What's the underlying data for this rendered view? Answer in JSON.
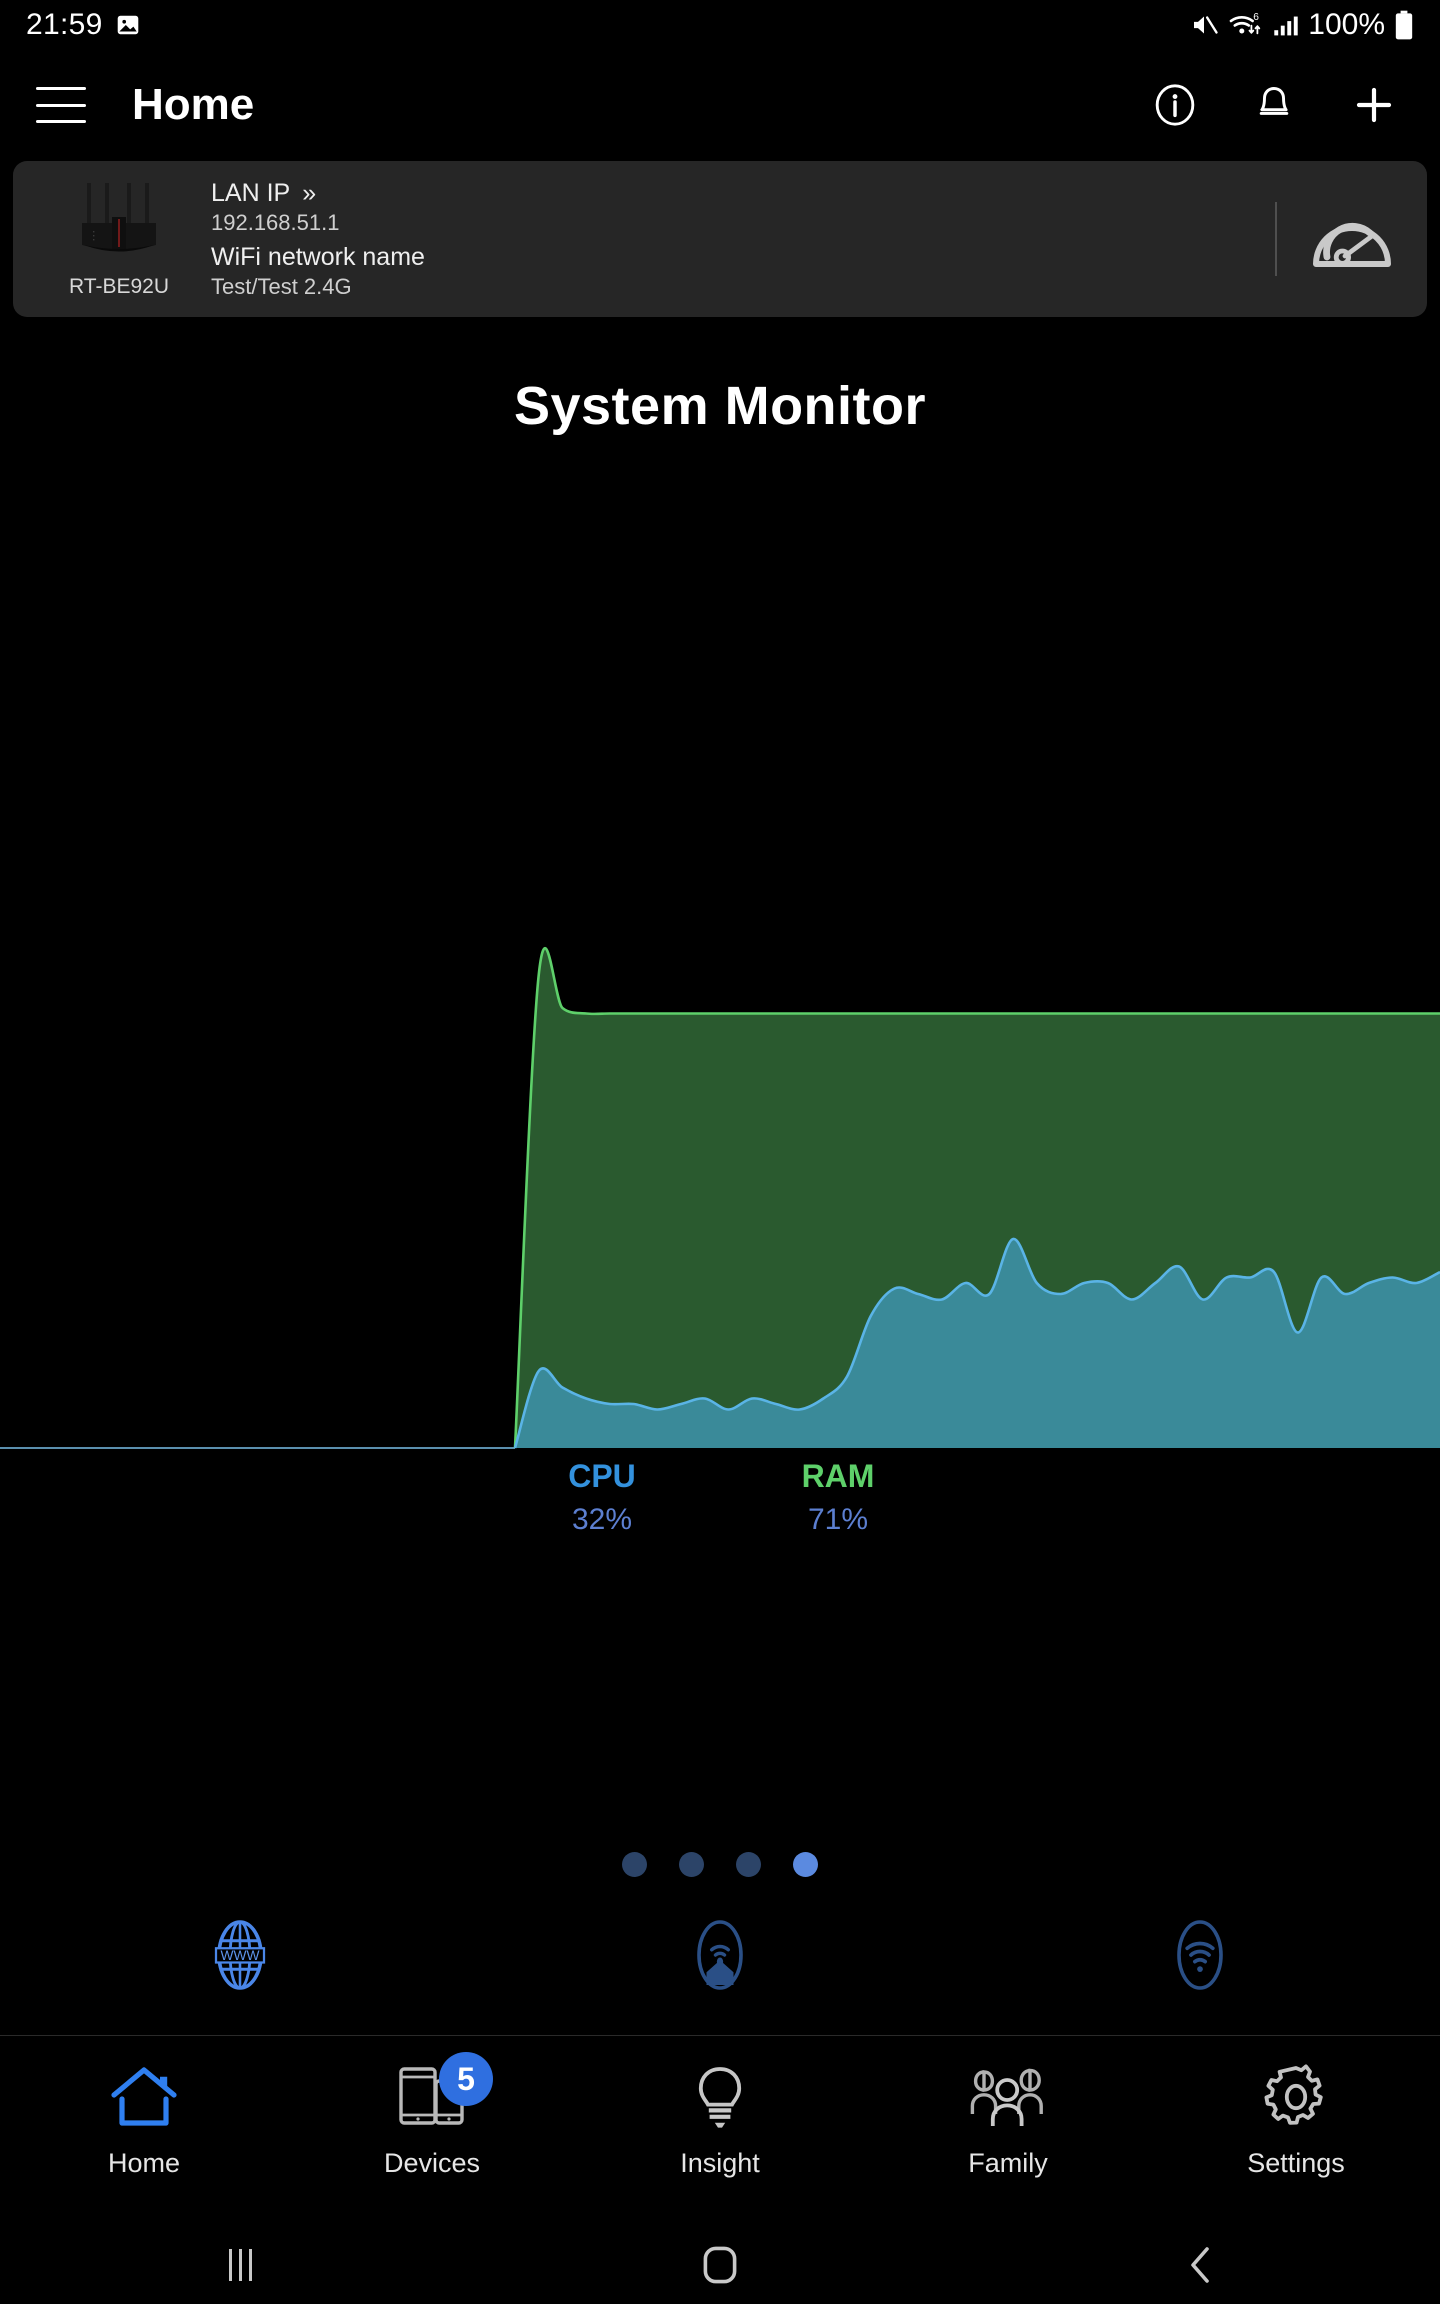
{
  "statusbar": {
    "time": "21:59",
    "battery_percent": "100%",
    "icons": [
      "image-icon",
      "mute-icon",
      "wifi6-icon",
      "signal-bars-icon",
      "battery-icon"
    ]
  },
  "header": {
    "title": "Home",
    "menu_icon": "hamburger-menu-icon",
    "actions": [
      "info-icon",
      "notification-bell-icon",
      "add-plus-icon"
    ]
  },
  "router_card": {
    "model": "RT-BE92U",
    "lan_ip_label": "LAN IP",
    "chevron": "»",
    "lan_ip_value": "192.168.51.1",
    "wifi_label": "WiFi network name",
    "wifi_value": "Test/Test 2.4G",
    "speedtest_icon": "speedometer-icon"
  },
  "main": {
    "title": "System Monitor"
  },
  "chart_data": {
    "type": "area",
    "title": "System Monitor",
    "xlabel": "",
    "ylabel": "",
    "ylim": [
      0,
      100
    ],
    "grid": false,
    "legend_position": "bottom",
    "stacked_overlay": true,
    "colors": {
      "cpu_line": "#5AB4E6",
      "cpu_fill": "#3A8A99",
      "ram_line": "#5ED06A",
      "ram_fill": "#2A5A2F"
    },
    "series": [
      {
        "name": "RAM",
        "current": 71,
        "unit": "%",
        "color": "#5ED06A",
        "values": [
          0,
          86,
          80,
          79,
          79,
          79,
          79,
          79,
          79,
          79,
          79,
          79,
          79,
          79,
          79,
          79,
          79,
          79,
          79,
          79,
          79,
          79,
          79,
          79,
          79,
          79,
          79,
          79,
          79,
          79,
          79,
          79,
          79,
          79,
          79,
          79,
          79,
          79,
          79,
          79
        ]
      },
      {
        "name": "CPU",
        "current": 32,
        "unit": "%",
        "color": "#5AB4E6",
        "values": [
          0,
          14,
          11,
          9,
          8,
          8,
          7,
          8,
          9,
          7,
          9,
          8,
          7,
          9,
          13,
          24,
          29,
          28,
          27,
          30,
          28,
          38,
          30,
          28,
          30,
          30,
          27,
          30,
          33,
          27,
          31,
          31,
          32,
          21,
          31,
          28,
          30,
          31,
          30,
          32
        ]
      }
    ]
  },
  "legend": [
    {
      "name": "CPU",
      "value": "32%",
      "color": "#3391dd"
    },
    {
      "name": "RAM",
      "value": "71%",
      "color": "#5ED06A"
    }
  ],
  "pager": {
    "total": 4,
    "active_index": 3
  },
  "quick_icons": [
    {
      "name": "internet-www-icon",
      "state": "active"
    },
    {
      "name": "home-network-icon",
      "state": "inactive"
    },
    {
      "name": "wifi-signal-icon",
      "state": "inactive"
    }
  ],
  "bottom_nav": [
    {
      "label": "Home",
      "icon": "home-icon",
      "active": true,
      "badge": null
    },
    {
      "label": "Devices",
      "icon": "devices-icon",
      "active": false,
      "badge": "5"
    },
    {
      "label": "Insight",
      "icon": "lightbulb-icon",
      "active": false,
      "badge": null
    },
    {
      "label": "Family",
      "icon": "family-icon",
      "active": false,
      "badge": null
    },
    {
      "label": "Settings",
      "icon": "gear-icon",
      "active": false,
      "badge": null
    }
  ],
  "system_nav": {
    "recents": "recent-apps-icon",
    "home": "android-home-icon",
    "back": "android-back-icon"
  }
}
